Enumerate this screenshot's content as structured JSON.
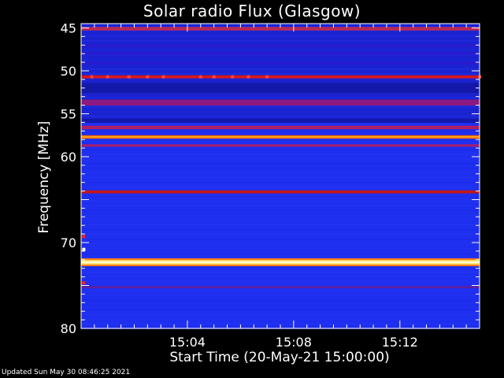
{
  "header": {
    "title": "Solar radio Flux (Glasgow)"
  },
  "footer": {
    "updated": "Updated Sun May 30 08:46:25 2021"
  },
  "chart_data": {
    "type": "heatmap",
    "title": "Solar radio Flux (Glasgow)",
    "xlabel": "Start Time (20-May-21 15:00:00)",
    "ylabel": "Frequency [MHz]",
    "x_range_minutes": [
      0,
      15
    ],
    "y_range_mhz": [
      44.5,
      80.0
    ],
    "y_ticks": [
      45,
      50,
      55,
      60,
      70,
      80
    ],
    "x_ticks": [
      {
        "minute": 4,
        "label": "15:04"
      },
      {
        "minute": 8,
        "label": "15:08"
      },
      {
        "minute": 12,
        "label": "15:12"
      }
    ],
    "background_color": "#1f2ff0",
    "emission_bands": [
      {
        "freq_mhz": 45.1,
        "width_mhz": 0.4,
        "intensity": "medium",
        "color": "#c02850"
      },
      {
        "freq_mhz": 47.1,
        "width_mhz": 0.3,
        "intensity": "low",
        "color": "#2a1ad0"
      },
      {
        "freq_mhz": 48.0,
        "width_mhz": 0.3,
        "intensity": "low",
        "color": "#2a1ad0"
      },
      {
        "freq_mhz": 49.1,
        "width_mhz": 0.3,
        "intensity": "low",
        "color": "#2a1ad0"
      },
      {
        "freq_mhz": 50.7,
        "width_mhz": 0.35,
        "intensity": "high",
        "color": "#d81818"
      },
      {
        "freq_mhz": 52.0,
        "width_mhz": 1.2,
        "intensity": "low",
        "color": "#1418a8"
      },
      {
        "freq_mhz": 53.7,
        "width_mhz": 0.7,
        "intensity": "medium",
        "color": "#8c1a80"
      },
      {
        "freq_mhz": 55.8,
        "width_mhz": 0.5,
        "intensity": "low",
        "color": "#1418a8"
      },
      {
        "freq_mhz": 56.6,
        "width_mhz": 0.4,
        "intensity": "medium",
        "color": "#b02060"
      },
      {
        "freq_mhz": 57.7,
        "width_mhz": 0.4,
        "intensity": "very high",
        "color": "#ff6a00"
      },
      {
        "freq_mhz": 58.7,
        "width_mhz": 0.3,
        "intensity": "medium",
        "color": "#a02070"
      },
      {
        "freq_mhz": 64.1,
        "width_mhz": 0.35,
        "intensity": "high",
        "color": "#c01818"
      },
      {
        "freq_mhz": 72.3,
        "width_mhz": 0.55,
        "intensity": "saturated",
        "color": "#ffe060"
      },
      {
        "freq_mhz": 75.2,
        "width_mhz": 0.25,
        "intensity": "low",
        "color": "#6020a0"
      }
    ],
    "burst_spots": [
      {
        "minute": 0.4,
        "freq_mhz": 50.7,
        "color": "#ff4040"
      },
      {
        "minute": 1.0,
        "freq_mhz": 50.7,
        "color": "#ff4040"
      },
      {
        "minute": 1.8,
        "freq_mhz": 50.7,
        "color": "#ff4040"
      },
      {
        "minute": 2.5,
        "freq_mhz": 50.7,
        "color": "#ff4040"
      },
      {
        "minute": 3.1,
        "freq_mhz": 50.7,
        "color": "#ff4040"
      },
      {
        "minute": 4.5,
        "freq_mhz": 50.7,
        "color": "#ff4040"
      },
      {
        "minute": 5.0,
        "freq_mhz": 50.7,
        "color": "#ff4040"
      },
      {
        "minute": 5.7,
        "freq_mhz": 50.7,
        "color": "#ff4040"
      },
      {
        "minute": 6.3,
        "freq_mhz": 50.7,
        "color": "#ff4040"
      },
      {
        "minute": 7.0,
        "freq_mhz": 50.7,
        "color": "#ff4040"
      },
      {
        "minute": 15.0,
        "freq_mhz": 50.7,
        "color": "#ff4040"
      },
      {
        "minute": 0.1,
        "freq_mhz": 69.3,
        "color": "#ff2020"
      },
      {
        "minute": 0.1,
        "freq_mhz": 70.8,
        "color": "#ffffff"
      },
      {
        "minute": 0.1,
        "freq_mhz": 74.7,
        "color": "#ff2020"
      }
    ]
  }
}
